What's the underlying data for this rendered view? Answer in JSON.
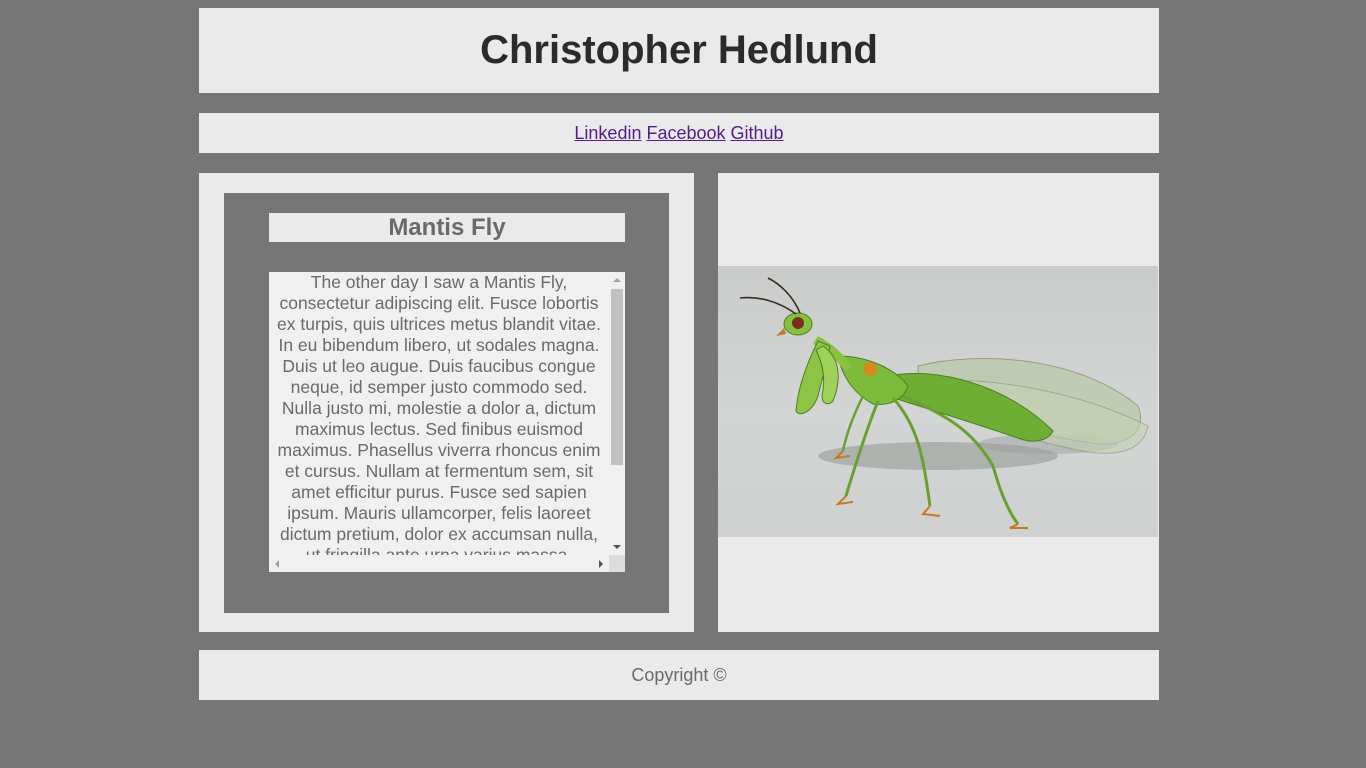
{
  "header": {
    "title": "Christopher Hedlund"
  },
  "nav": {
    "links": [
      {
        "label": "Linkedin"
      },
      {
        "label": "Facebook"
      },
      {
        "label": "Github"
      }
    ]
  },
  "article": {
    "title": "Mantis Fly",
    "body": "The other day I saw a Mantis Fly, consectetur adipiscing elit. Fusce lobortis ex turpis, quis ultrices metus blandit vitae. In eu bibendum libero, ut sodales magna. Duis ut leo augue. Duis faucibus congue neque, id semper justo commodo sed. Nulla justo mi, molestie a dolor a, dictum maximus lectus. Sed finibus euismod maximus. Phasellus viverra rhoncus enim et cursus. Nullam at fermentum sem, sit amet efficitur purus. Fusce sed sapien ipsum. Mauris ullamcorper, felis laoreet dictum pretium, dolor ex accumsan nulla, ut fringilla ante urna varius massa."
  },
  "image": {
    "subject": "mantis-fly-photo"
  },
  "footer": {
    "text": "Copyright ©"
  },
  "colors": {
    "background": "#767676",
    "panel": "#eaeaea",
    "link": "#551a8b",
    "heading": "#2b2b2b",
    "text": "#6a6a6a"
  }
}
